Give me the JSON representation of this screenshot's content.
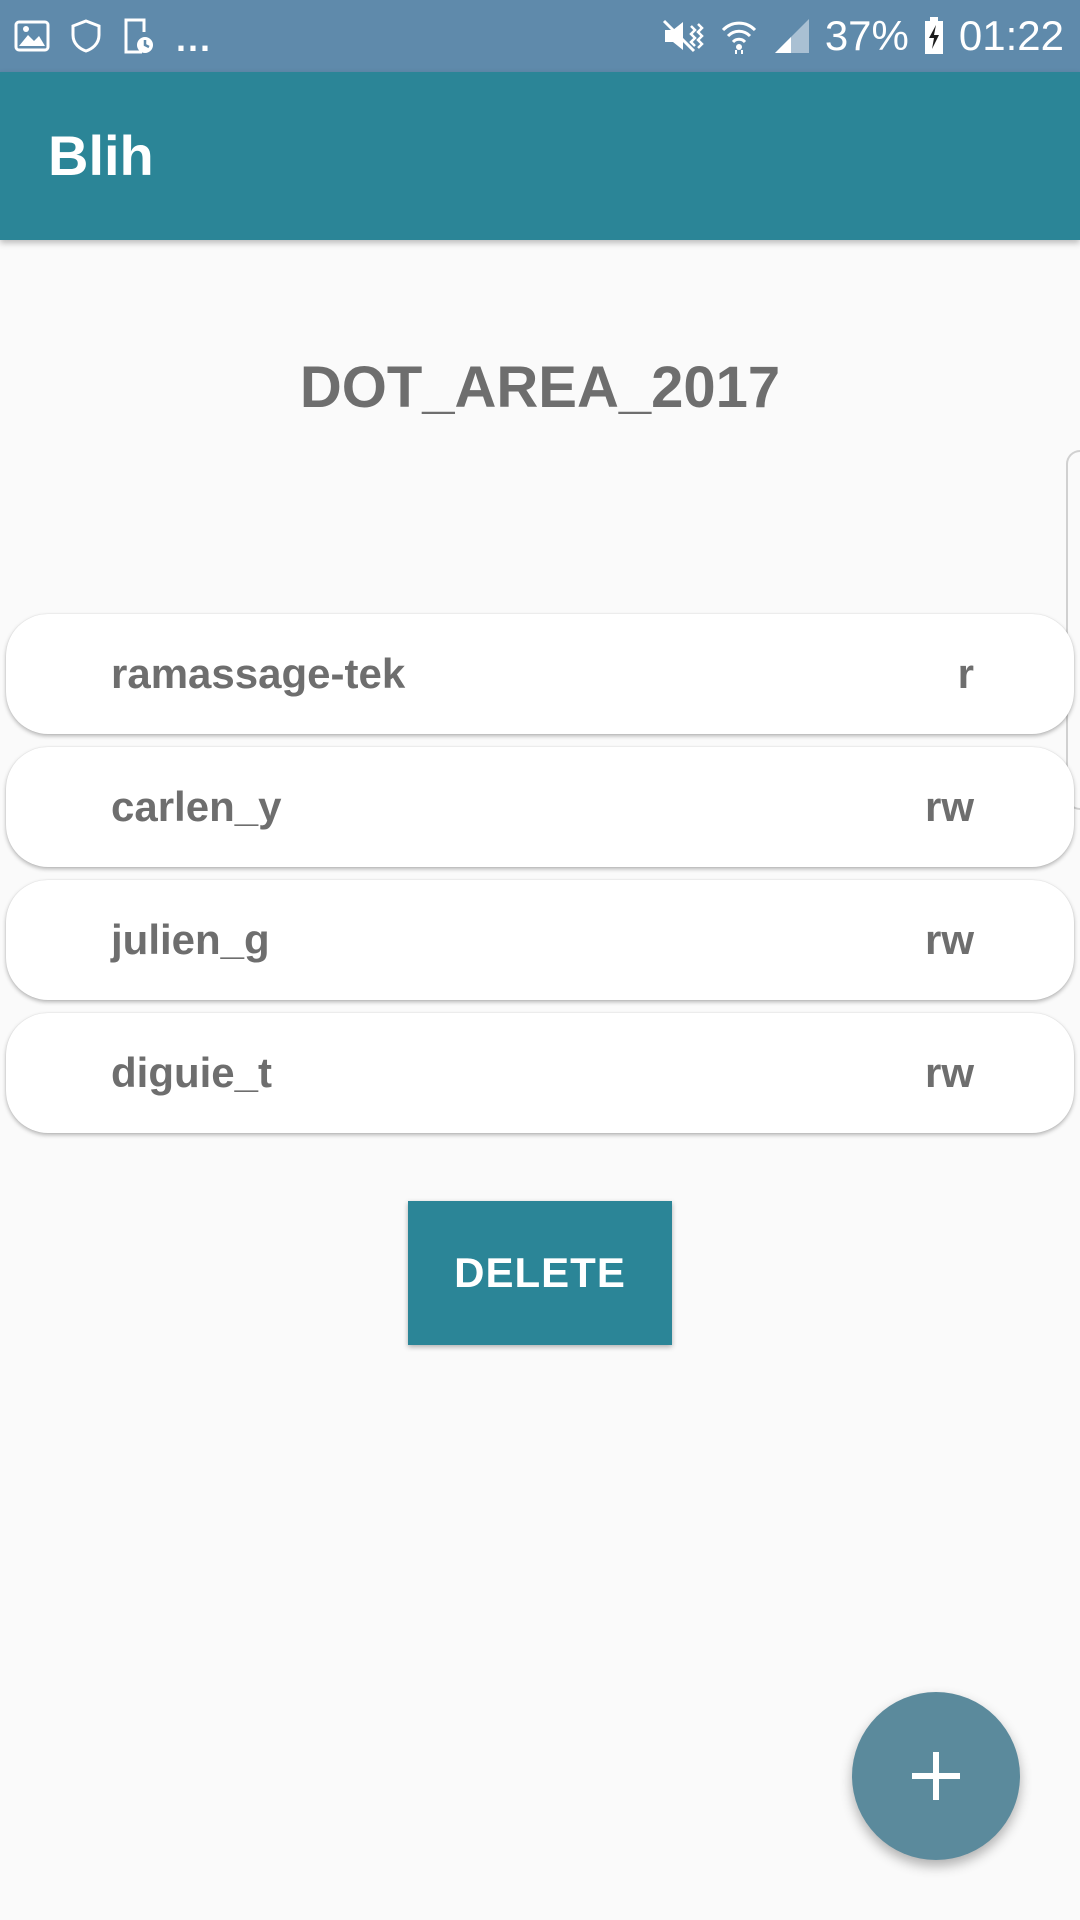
{
  "status_bar": {
    "left_icons": [
      "image-icon",
      "shield-icon",
      "clipboard-clock-icon"
    ],
    "overflow": "...",
    "battery_percent": "37%",
    "time": "01:22",
    "right_icons": [
      "mute-vibrate-icon",
      "wifi-icon",
      "signal-icon",
      "battery-charging-icon"
    ]
  },
  "app_bar": {
    "title": "Blih"
  },
  "repo": {
    "name": "DOT_AREA_2017"
  },
  "acl": [
    {
      "user": "ramassage-tek",
      "rights": "r"
    },
    {
      "user": "carlen_y",
      "rights": "rw"
    },
    {
      "user": "julien_g",
      "rights": "rw"
    },
    {
      "user": "diguie_t",
      "rights": "rw"
    }
  ],
  "actions": {
    "delete_label": "DELETE",
    "fab_icon": "plus-icon"
  },
  "colors": {
    "status_bar": "#5f8aab",
    "primary": "#2b8597",
    "fab": "#5b8a9c",
    "text_gray": "#6e6e6e",
    "background": "#fafafa"
  }
}
